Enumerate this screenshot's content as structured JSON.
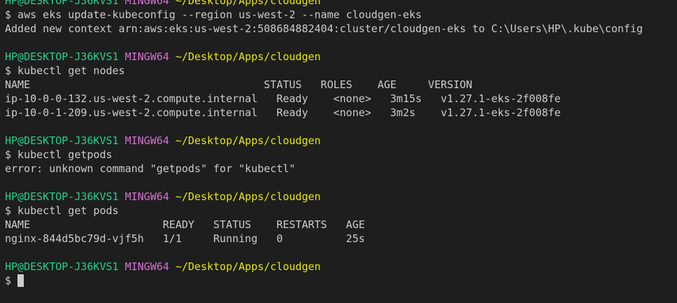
{
  "prompt": {
    "user_host": "HP@DESKTOP-J36KVS1",
    "shell": "MINGW64",
    "cwd": "~/Desktop/Apps/cloudgen",
    "symbol": "$"
  },
  "lines": [
    "$ aws eks update-kubeconfig --region us-west-2 --name cloudgen-eks",
    "Added new context arn:aws:eks:us-west-2:508684882404:cluster/cloudgen-eks to C:\\Users\\HP\\.kube\\config",
    "",
    "$ kubectl get nodes",
    "NAME                                     STATUS   ROLES    AGE     VERSION",
    "ip-10-0-0-132.us-west-2.compute.internal   Ready    <none>   3m15s   v1.27.1-eks-2f008fe",
    "ip-10-0-1-209.us-west-2.compute.internal   Ready    <none>   3m2s    v1.27.1-eks-2f008fe",
    "",
    "$ kubectl getpods",
    "error: unknown command \"getpods\" for \"kubectl\"",
    "",
    "$ kubectl get pods",
    "NAME                     READY   STATUS    RESTARTS   AGE",
    "nginx-844d5bc79d-vjf5h   1/1     Running   0          25s",
    "",
    "$"
  ],
  "nodes_table": {
    "headers": [
      "NAME",
      "STATUS",
      "ROLES",
      "AGE",
      "VERSION"
    ],
    "rows": [
      [
        "ip-10-0-0-132.us-west-2.compute.internal",
        "Ready",
        "<none>",
        "3m15s",
        "v1.27.1-eks-2f008fe"
      ],
      [
        "ip-10-0-1-209.us-west-2.compute.internal",
        "Ready",
        "<none>",
        "3m2s",
        "v1.27.1-eks-2f008fe"
      ]
    ]
  },
  "pods_table": {
    "headers": [
      "NAME",
      "READY",
      "STATUS",
      "RESTARTS",
      "AGE"
    ],
    "rows": [
      [
        "nginx-844d5bc79d-vjf5h",
        "1/1",
        "Running",
        "0",
        "25s"
      ]
    ]
  },
  "colors": {
    "background": "#1e1e1e",
    "text": "#cccccc",
    "user_host": "#23d18b",
    "shell": "#d670d6",
    "cwd": "#e5e510"
  }
}
